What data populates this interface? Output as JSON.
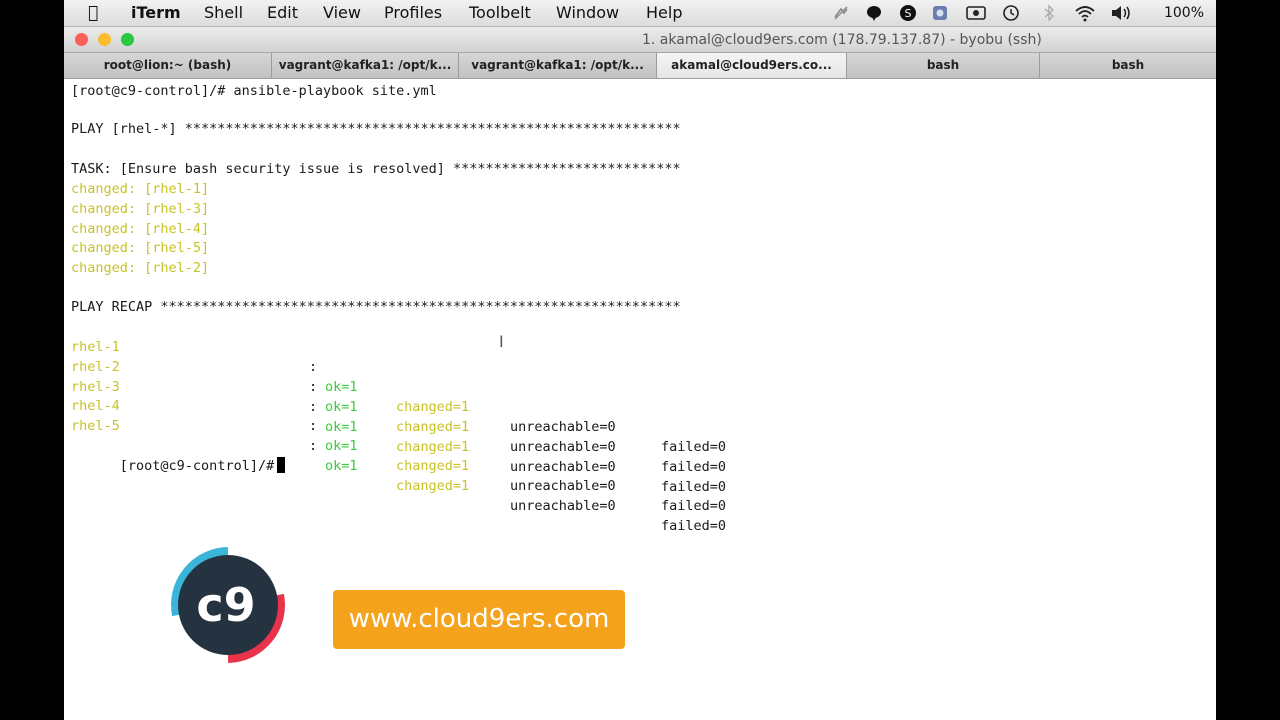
{
  "menubar": {
    "app": "iTerm",
    "items": [
      "Shell",
      "Edit",
      "View",
      "Profiles",
      "Toolbelt",
      "Window",
      "Help"
    ],
    "battery": "100%",
    "tray_icons": [
      "muted-icon",
      "chat-icon",
      "skype-icon",
      "sync-icon",
      "screen-icon",
      "time-machine-icon",
      "bluetooth-icon",
      "wifi-icon",
      "volume-icon"
    ]
  },
  "window": {
    "title": "1. akamal@cloud9ers.com (178.79.137.87) - byobu (ssh)",
    "colors": {
      "close": "#fc5f57",
      "minimize": "#fdbc2e",
      "zoom": "#28c840"
    }
  },
  "tabs": [
    "root@lion:~ (bash)",
    "vagrant@kafka1: /opt/k...",
    "vagrant@kafka1: /opt/k...",
    "akamal@cloud9ers.co...",
    "bash",
    "bash"
  ],
  "terminal": {
    "command_line": "[root@c9-control]/# ansible-playbook site.yml",
    "play_line": "PLAY [rhel-*] *************************************************************",
    "task_line": "TASK: [Ensure bash security issue is resolved] ****************************",
    "changed": [
      "changed: [rhel-1]",
      "changed: [rhel-3]",
      "changed: [rhel-4]",
      "changed: [rhel-5]",
      "changed: [rhel-2]"
    ],
    "recap_line": "PLAY RECAP ****************************************************************",
    "recap_rows": [
      {
        "host": "rhel-1",
        "ok": "ok=1",
        "changed": "changed=1",
        "unreachable": "unreachable=0",
        "failed": "failed=0"
      },
      {
        "host": "rhel-2",
        "ok": "ok=1",
        "changed": "changed=1",
        "unreachable": "unreachable=0",
        "failed": "failed=0"
      },
      {
        "host": "rhel-3",
        "ok": "ok=1",
        "changed": "changed=1",
        "unreachable": "unreachable=0",
        "failed": "failed=0"
      },
      {
        "host": "rhel-4",
        "ok": "ok=1",
        "changed": "changed=1",
        "unreachable": "unreachable=0",
        "failed": "failed=0"
      },
      {
        "host": "rhel-5",
        "ok": "ok=1",
        "changed": "changed=1",
        "unreachable": "unreachable=0",
        "failed": "failed=0"
      }
    ],
    "prompt": "[root@c9-control]/#",
    "colors": {
      "changed": "#c9c227",
      "ok": "#3ec93e"
    }
  },
  "branding": {
    "website": "www.cloud9ers.com",
    "logo_text": "c9",
    "badge_color": "#f5a21c"
  }
}
